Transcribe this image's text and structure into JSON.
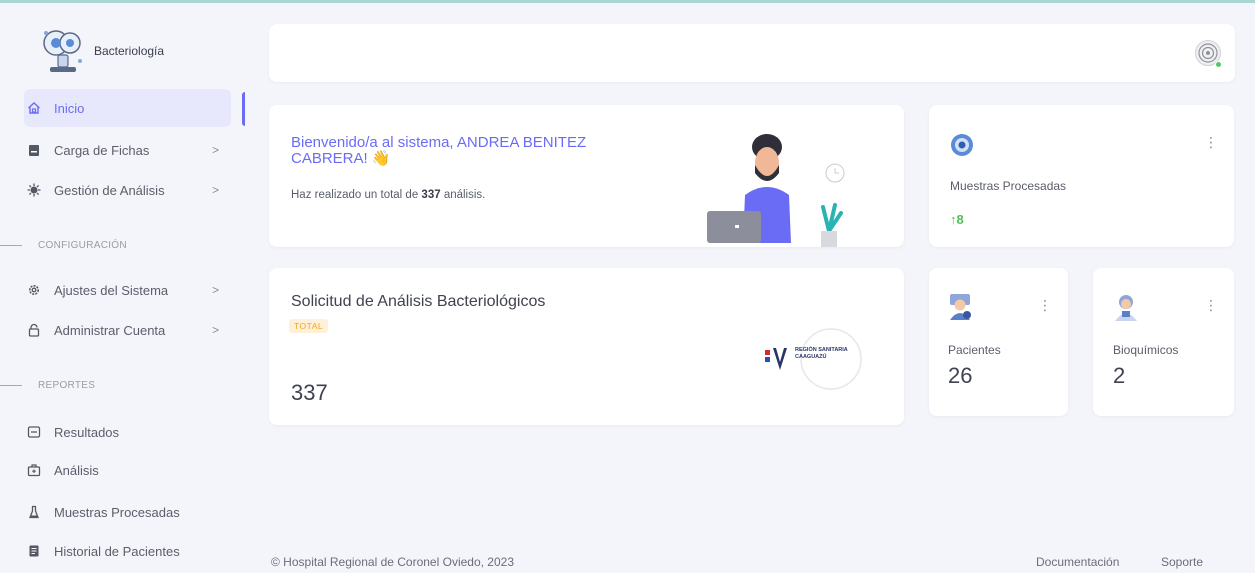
{
  "sidebar": {
    "brand": "Bacteriología",
    "items": [
      {
        "label": "Inicio",
        "icon": "home-icon"
      },
      {
        "label": "Carga de Fichas",
        "icon": "clipboard-icon",
        "chevron": ">"
      },
      {
        "label": "Gestión de Análisis",
        "icon": "virus-icon",
        "chevron": ">"
      }
    ],
    "sections": {
      "config": "CONFIGURACIÓN",
      "reportes": "REPORTES"
    },
    "config_items": [
      {
        "label": "Ajustes del Sistema",
        "icon": "gear-icon",
        "chevron": ">"
      },
      {
        "label": "Administrar Cuenta",
        "icon": "lock-icon",
        "chevron": ">"
      }
    ],
    "report_items": [
      {
        "label": "Resultados",
        "icon": "results-icon"
      },
      {
        "label": "Análisis",
        "icon": "analysis-icon"
      },
      {
        "label": "Muestras Procesadas",
        "icon": "flask-icon"
      },
      {
        "label": "Historial de Pacientes",
        "icon": "document-icon"
      }
    ]
  },
  "welcome": {
    "title": "Bienvenido/a al sistema, ANDREA BENITEZ CABRERA!",
    "emoji": "👋",
    "text_prefix": "Haz realizado un total de",
    "total": "337",
    "text_suffix": "análisis."
  },
  "muestras": {
    "label": "Muestras Procesadas",
    "trend": "↑8"
  },
  "solicitud": {
    "title": "Solicitud de Análisis Bacteriológicos",
    "badge": "TOTAL",
    "value": "337",
    "logo_text": "REGIÓN SANITARIA CAAGUAZÚ"
  },
  "pacientes": {
    "label": "Pacientes",
    "value": "26"
  },
  "bioquimicos": {
    "label": "Bioquímicos",
    "value": "2"
  },
  "footer": {
    "copyright": "© Hospital Regional de Coronel Oviedo, 2023",
    "doc": "Documentación",
    "support": "Soporte"
  },
  "colors": {
    "primary": "#6a6cf6",
    "success": "#52c254",
    "warning": "#f3a21e",
    "background": "#f4f5fa"
  }
}
